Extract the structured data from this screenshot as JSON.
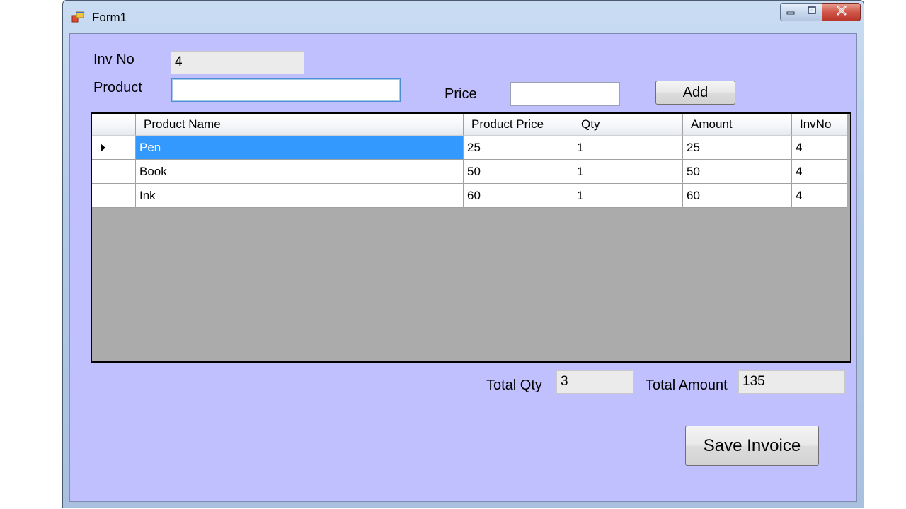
{
  "window": {
    "title": "Form1",
    "icons": {
      "app": "form-app-icon",
      "minimize": "minimize-icon",
      "maximize": "maximize-icon",
      "close": "close-icon"
    }
  },
  "form": {
    "inv_no_label": "Inv No",
    "inv_no_value": "4",
    "product_label": "Product",
    "product_value": "",
    "price_label": "Price",
    "price_value": "",
    "add_label": "Add",
    "total_qty_label": "Total Qty",
    "total_qty_value": "3",
    "total_amount_label": "Total Amount",
    "total_amount_value": "135",
    "save_label": "Save Invoice"
  },
  "grid": {
    "columns": [
      "Product Name",
      "Product Price",
      "Qty",
      "Amount",
      "InvNo"
    ],
    "rows": [
      {
        "name": "Pen",
        "price": "25",
        "qty": "1",
        "amount": "25",
        "inv": "4",
        "selected": true
      },
      {
        "name": "Book",
        "price": "50",
        "qty": "1",
        "amount": "50",
        "inv": "4",
        "selected": false
      },
      {
        "name": "Ink",
        "price": "60",
        "qty": "1",
        "amount": "60",
        "inv": "4",
        "selected": false
      }
    ]
  },
  "colors": {
    "form_background": "#c0c0ff",
    "grid_background": "#ababab",
    "selection": "#3399ff",
    "readonly_field": "#ebebeb"
  }
}
